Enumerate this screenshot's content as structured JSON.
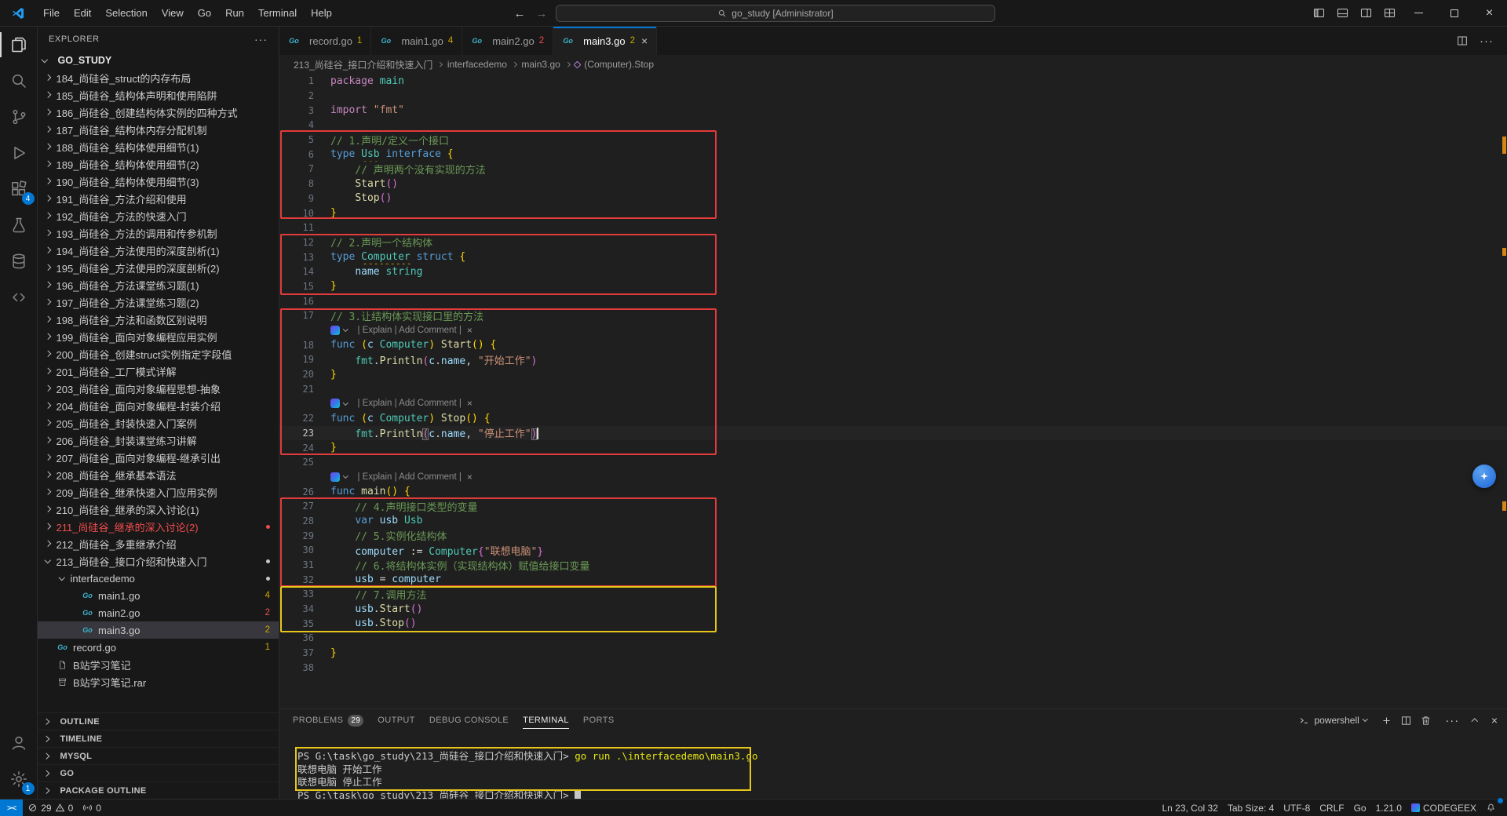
{
  "titlebar": {
    "menus": [
      "File",
      "Edit",
      "Selection",
      "View",
      "Go",
      "Run",
      "Terminal",
      "Help"
    ],
    "nav_back": "←",
    "nav_forward": "→",
    "command_center": "go_study [Administrator]"
  },
  "activitybar": {
    "top": [
      {
        "icon": "explorer-icon",
        "active": true
      },
      {
        "icon": "search-icon"
      },
      {
        "icon": "source-control-icon"
      },
      {
        "icon": "run-debug-icon"
      },
      {
        "icon": "extensions-icon",
        "badge": "4"
      },
      {
        "icon": "testing-icon"
      },
      {
        "icon": "database-icon"
      },
      {
        "icon": "codegeex-icon"
      }
    ],
    "bottom": [
      {
        "icon": "account-icon"
      },
      {
        "icon": "settings-gear-icon",
        "badge": "1"
      }
    ]
  },
  "explorer": {
    "title": "EXPLORER",
    "more": "···",
    "root": "GO_STUDY",
    "items": [
      {
        "label": "184_尚硅谷_struct的内存布局",
        "kind": "folder"
      },
      {
        "label": "185_尚硅谷_结构体声明和使用陷阱",
        "kind": "folder"
      },
      {
        "label": "186_尚硅谷_创建结构体实例的四种方式",
        "kind": "folder"
      },
      {
        "label": "187_尚硅谷_结构体内存分配机制",
        "kind": "folder"
      },
      {
        "label": "188_尚硅谷_结构体使用细节(1)",
        "kind": "folder"
      },
      {
        "label": "189_尚硅谷_结构体使用细节(2)",
        "kind": "folder"
      },
      {
        "label": "190_尚硅谷_结构体使用细节(3)",
        "kind": "folder"
      },
      {
        "label": "191_尚硅谷_方法介绍和使用",
        "kind": "folder"
      },
      {
        "label": "192_尚硅谷_方法的快速入门",
        "kind": "folder"
      },
      {
        "label": "193_尚硅谷_方法的调用和传参机制",
        "kind": "folder"
      },
      {
        "label": "194_尚硅谷_方法使用的深度剖析(1)",
        "kind": "folder"
      },
      {
        "label": "195_尚硅谷_方法使用的深度剖析(2)",
        "kind": "folder"
      },
      {
        "label": "196_尚硅谷_方法课堂练习题(1)",
        "kind": "folder"
      },
      {
        "label": "197_尚硅谷_方法课堂练习题(2)",
        "kind": "folder"
      },
      {
        "label": "198_尚硅谷_方法和函数区别说明",
        "kind": "folder"
      },
      {
        "label": "199_尚硅谷_面向对象编程应用实例",
        "kind": "folder"
      },
      {
        "label": "200_尚硅谷_创建struct实例指定字段值",
        "kind": "folder"
      },
      {
        "label": "201_尚硅谷_工厂模式详解",
        "kind": "folder"
      },
      {
        "label": "203_尚硅谷_面向对象编程思想-抽象",
        "kind": "folder"
      },
      {
        "label": "204_尚硅谷_面向对象编程-封装介绍",
        "kind": "folder"
      },
      {
        "label": "205_尚硅谷_封装快速入门案例",
        "kind": "folder"
      },
      {
        "label": "206_尚硅谷_封装课堂练习讲解",
        "kind": "folder"
      },
      {
        "label": "207_尚硅谷_面向对象编程-继承引出",
        "kind": "folder"
      },
      {
        "label": "208_尚硅谷_继承基本语法",
        "kind": "folder"
      },
      {
        "label": "209_尚硅谷_继承快速入门应用实例",
        "kind": "folder"
      },
      {
        "label": "210_尚硅谷_继承的深入讨论(1)",
        "kind": "folder"
      },
      {
        "label": "211_尚硅谷_继承的深入讨论(2)",
        "kind": "folder",
        "error": true,
        "dot": "#f14c4c"
      },
      {
        "label": "212_尚硅谷_多重继承介绍",
        "kind": "folder"
      },
      {
        "label": "213_尚硅谷_接口介绍和快速入门",
        "kind": "folder",
        "expanded": true,
        "dot": "#c5c5c5"
      },
      {
        "label": "interfacedemo",
        "kind": "folder",
        "level": 1,
        "expanded": true,
        "dot": "#c5c5c5"
      },
      {
        "label": "main1.go",
        "kind": "go",
        "level": 2,
        "badge": "4"
      },
      {
        "label": "main2.go",
        "kind": "go",
        "level": 2,
        "badge": "2",
        "severity": "error"
      },
      {
        "label": "main3.go",
        "kind": "go",
        "level": 2,
        "badge": "2",
        "selected": true
      },
      {
        "label": "record.go",
        "kind": "go",
        "badge": "1"
      },
      {
        "label": "B站学习笔记",
        "kind": "doc"
      },
      {
        "label": "B站学习笔记.rar",
        "kind": "archive"
      }
    ],
    "sections": [
      "OUTLINE",
      "TIMELINE",
      "MYSQL",
      "GO",
      "PACKAGE OUTLINE"
    ]
  },
  "tabs": [
    {
      "name": "record.go",
      "badge": "1"
    },
    {
      "name": "main1.go",
      "badge": "4"
    },
    {
      "name": "main2.go",
      "badge": "2",
      "severity": "error"
    },
    {
      "name": "main3.go",
      "badge": "2",
      "active": true
    }
  ],
  "breadcrumb": [
    "213_尚硅谷_接口介绍和快速入门",
    "interfacedemo",
    "main3.go",
    "(Computer).Stop"
  ],
  "editor": {
    "codelens": {
      "text": "| Explain | Add Comment |",
      "close": "×"
    },
    "rows": [
      {
        "n": 1,
        "t": [
          [
            "kwp",
            "package"
          ],
          [
            "pl",
            " "
          ],
          [
            "ty",
            "main"
          ]
        ]
      },
      {
        "n": 2,
        "t": []
      },
      {
        "n": 3,
        "t": [
          [
            "kwp",
            "import"
          ],
          [
            "pl",
            " "
          ],
          [
            "st",
            "\"fmt\""
          ]
        ]
      },
      {
        "n": 4,
        "t": []
      },
      {
        "n": 5,
        "t": [
          [
            "co",
            "// 1.声明/定义一个接口"
          ]
        ]
      },
      {
        "n": 6,
        "t": [
          [
            "kw",
            "type"
          ],
          [
            "pl",
            " "
          ],
          [
            "tyw",
            "Usb"
          ],
          [
            "pl",
            " "
          ],
          [
            "kw",
            "interface"
          ],
          [
            "pl",
            " "
          ],
          [
            "b1",
            "{"
          ]
        ]
      },
      {
        "n": 7,
        "t": [
          [
            "pl",
            "    "
          ],
          [
            "co",
            "// 声明两个没有实现的方法"
          ]
        ]
      },
      {
        "n": 8,
        "t": [
          [
            "pl",
            "    "
          ],
          [
            "fn",
            "Start"
          ],
          [
            "b2",
            "()"
          ]
        ]
      },
      {
        "n": 9,
        "t": [
          [
            "pl",
            "    "
          ],
          [
            "fn",
            "Stop"
          ],
          [
            "b2",
            "()"
          ]
        ]
      },
      {
        "n": 10,
        "t": [
          [
            "b1",
            "}"
          ]
        ]
      },
      {
        "n": 11,
        "t": []
      },
      {
        "n": 12,
        "t": [
          [
            "co",
            "// 2.声明一个结构体"
          ]
        ]
      },
      {
        "n": 13,
        "t": [
          [
            "kw",
            "type"
          ],
          [
            "pl",
            " "
          ],
          [
            "tyw",
            "Computer"
          ],
          [
            "pl",
            " "
          ],
          [
            "kw",
            "struct"
          ],
          [
            "pl",
            " "
          ],
          [
            "b1",
            "{"
          ]
        ]
      },
      {
        "n": 14,
        "t": [
          [
            "pl",
            "    "
          ],
          [
            "pr",
            "name"
          ],
          [
            "pl",
            " "
          ],
          [
            "ty",
            "string"
          ]
        ]
      },
      {
        "n": 15,
        "t": [
          [
            "b1",
            "}"
          ]
        ]
      },
      {
        "n": 16,
        "t": []
      },
      {
        "n": 17,
        "t": [
          [
            "co",
            "// 3.让结构体实现接口里的方法"
          ]
        ]
      },
      {
        "lens": true
      },
      {
        "n": 18,
        "t": [
          [
            "kw",
            "func"
          ],
          [
            "pl",
            " "
          ],
          [
            "b1",
            "("
          ],
          [
            "va",
            "c"
          ],
          [
            "pl",
            " "
          ],
          [
            "ty",
            "Computer"
          ],
          [
            "b1",
            ")"
          ],
          [
            "pl",
            " "
          ],
          [
            "fn",
            "Start"
          ],
          [
            "b1",
            "()"
          ],
          [
            "pl",
            " "
          ],
          [
            "b1",
            "{"
          ]
        ]
      },
      {
        "n": 19,
        "t": [
          [
            "pl",
            "    "
          ],
          [
            "ty",
            "fmt"
          ],
          [
            "pu",
            "."
          ],
          [
            "fn",
            "Println"
          ],
          [
            "b2",
            "("
          ],
          [
            "va",
            "c"
          ],
          [
            "pu",
            "."
          ],
          [
            "pr",
            "name"
          ],
          [
            "pu",
            ", "
          ],
          [
            "st",
            "\"开始工作\""
          ],
          [
            "b2",
            ")"
          ]
        ]
      },
      {
        "n": 20,
        "t": [
          [
            "b1",
            "}"
          ]
        ]
      },
      {
        "n": 21,
        "t": []
      },
      {
        "lens": true
      },
      {
        "n": 22,
        "t": [
          [
            "kw",
            "func"
          ],
          [
            "pl",
            " "
          ],
          [
            "b1",
            "("
          ],
          [
            "va",
            "c"
          ],
          [
            "pl",
            " "
          ],
          [
            "ty",
            "Computer"
          ],
          [
            "b1",
            ")"
          ],
          [
            "pl",
            " "
          ],
          [
            "fn",
            "Stop"
          ],
          [
            "b1",
            "()"
          ],
          [
            "pl",
            " "
          ],
          [
            "b1",
            "{"
          ]
        ]
      },
      {
        "n": 23,
        "cur": true,
        "t": [
          [
            "pl",
            "    "
          ],
          [
            "ty",
            "fmt"
          ],
          [
            "pu",
            "."
          ],
          [
            "fn",
            "Println"
          ],
          [
            "b2 bm",
            "("
          ],
          [
            "va",
            "c"
          ],
          [
            "pu",
            "."
          ],
          [
            "pr",
            "name"
          ],
          [
            "pu",
            ", "
          ],
          [
            "st",
            "\"停止工作\""
          ],
          [
            "b2 bm",
            ")"
          ],
          [
            "cur",
            ""
          ]
        ]
      },
      {
        "n": 24,
        "t": [
          [
            "b1",
            "}"
          ]
        ]
      },
      {
        "n": 25,
        "t": []
      },
      {
        "lens": true
      },
      {
        "n": 26,
        "t": [
          [
            "kw",
            "func"
          ],
          [
            "pl",
            " "
          ],
          [
            "fn",
            "main"
          ],
          [
            "b1",
            "()"
          ],
          [
            "pl",
            " "
          ],
          [
            "b1",
            "{"
          ]
        ]
      },
      {
        "n": 27,
        "t": [
          [
            "pl",
            "    "
          ],
          [
            "co",
            "// 4.声明接口类型的变量"
          ]
        ]
      },
      {
        "n": 28,
        "t": [
          [
            "pl",
            "    "
          ],
          [
            "kw",
            "var"
          ],
          [
            "pl",
            " "
          ],
          [
            "va",
            "usb"
          ],
          [
            "pl",
            " "
          ],
          [
            "ty",
            "Usb"
          ]
        ]
      },
      {
        "n": 29,
        "t": [
          [
            "pl",
            "    "
          ],
          [
            "co",
            "// 5.实例化结构体"
          ]
        ]
      },
      {
        "n": 30,
        "t": [
          [
            "pl",
            "    "
          ],
          [
            "va",
            "computer"
          ],
          [
            "pl",
            " "
          ],
          [
            "pu",
            ":="
          ],
          [
            "pl",
            " "
          ],
          [
            "ty",
            "Computer"
          ],
          [
            "b2",
            "{"
          ],
          [
            "st",
            "\"联想电脑\""
          ],
          [
            "b2",
            "}"
          ]
        ]
      },
      {
        "n": 31,
        "t": [
          [
            "pl",
            "    "
          ],
          [
            "co",
            "// 6.将结构体实例（实现结构体）赋值给接口变量"
          ]
        ]
      },
      {
        "n": 32,
        "t": [
          [
            "pl",
            "    "
          ],
          [
            "va",
            "usb"
          ],
          [
            "pl",
            " "
          ],
          [
            "pu",
            "="
          ],
          [
            "pl",
            " "
          ],
          [
            "va",
            "computer"
          ]
        ]
      },
      {
        "n": 33,
        "t": [
          [
            "pl",
            "    "
          ],
          [
            "co",
            "// 7.调用方法"
          ]
        ]
      },
      {
        "n": 34,
        "t": [
          [
            "pl",
            "    "
          ],
          [
            "va",
            "usb"
          ],
          [
            "pu",
            "."
          ],
          [
            "fn",
            "Start"
          ],
          [
            "b2",
            "()"
          ]
        ]
      },
      {
        "n": 35,
        "t": [
          [
            "pl",
            "    "
          ],
          [
            "va",
            "usb"
          ],
          [
            "pu",
            "."
          ],
          [
            "fn",
            "Stop"
          ],
          [
            "b2",
            "()"
          ]
        ]
      },
      {
        "n": 36,
        "t": []
      },
      {
        "n": 37,
        "t": [
          [
            "b1",
            "}"
          ]
        ]
      },
      {
        "n": 38,
        "t": []
      }
    ]
  },
  "panel": {
    "tabs": [
      {
        "label": "PROBLEMS",
        "badge": "29"
      },
      {
        "label": "OUTPUT"
      },
      {
        "label": "DEBUG CONSOLE"
      },
      {
        "label": "TERMINAL",
        "active": true
      },
      {
        "label": "PORTS"
      }
    ],
    "shell": "powershell"
  },
  "terminal": {
    "lines": [
      {
        "s": [
          [
            "p",
            "PS G:\\task\\go_study\\213_尚硅谷_接口介绍和快速入门> "
          ],
          [
            "cmd",
            "go run .\\interfacedemo\\main3.go"
          ]
        ]
      },
      {
        "s": [
          [
            "out",
            "联想电脑 开始工作"
          ]
        ]
      },
      {
        "s": [
          [
            "out",
            "联想电脑 停止工作"
          ]
        ]
      },
      {
        "s": [
          [
            "p",
            "PS G:\\task\\go_study\\213_尚硅谷_接口介绍和快速入门> "
          ],
          [
            "cursor",
            ""
          ]
        ]
      }
    ]
  },
  "statusbar": {
    "remote": "><",
    "errors": "29",
    "warnings": "0",
    "ports": "0",
    "line_col": "Ln 23, Col 32",
    "tab_size": "Tab Size: 4",
    "encoding": "UTF-8",
    "eol": "CRLF",
    "language": "Go",
    "go_version": "1.21.0",
    "codegeex": "CODEGEEX"
  },
  "colors": {
    "accent": "#0078d4",
    "error": "#f14c4c",
    "warning": "#cca700",
    "annotation_red": "#e23b3b",
    "annotation_yellow": "#e7c61a"
  }
}
